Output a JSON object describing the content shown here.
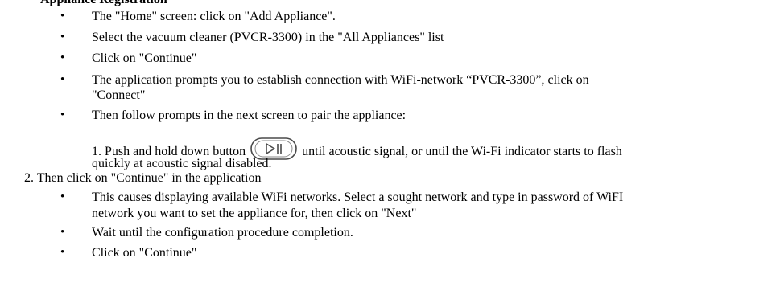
{
  "doc": {
    "heading_fragment": "Appliance Registration",
    "bullet_glyph": "•",
    "top_bullets": [
      "The \"Home\" screen:  click on \"Add Appliance\".",
      "Select the vacuum cleaner (PVCR-3300) in the \"All Appliances\" list",
      "Click on \"Continue\"",
      "The application prompts you to establish connection with WiFi-network “PVCR-3300”, click on",
      "\"Connect\"",
      "Then follow prompts in the next screen to pair the appliance:"
    ],
    "step1_before": "1. Push and hold down button",
    "step1_after": "until acoustic signal, or until the Wi-Fi indicator starts to flash",
    "step1_cont": "quickly at acoustic signal disabled.",
    "step2": "2. Then click on \"Continue\" in the application",
    "bottom_bullets": [
      "This causes displaying available WiFi networks. Select a sought network and type in password of WiFI",
      "network you want to set the appliance for, then click on \"Next\"",
      "Wait until the configuration procedure completion.",
      "Click on \"Continue\""
    ]
  }
}
